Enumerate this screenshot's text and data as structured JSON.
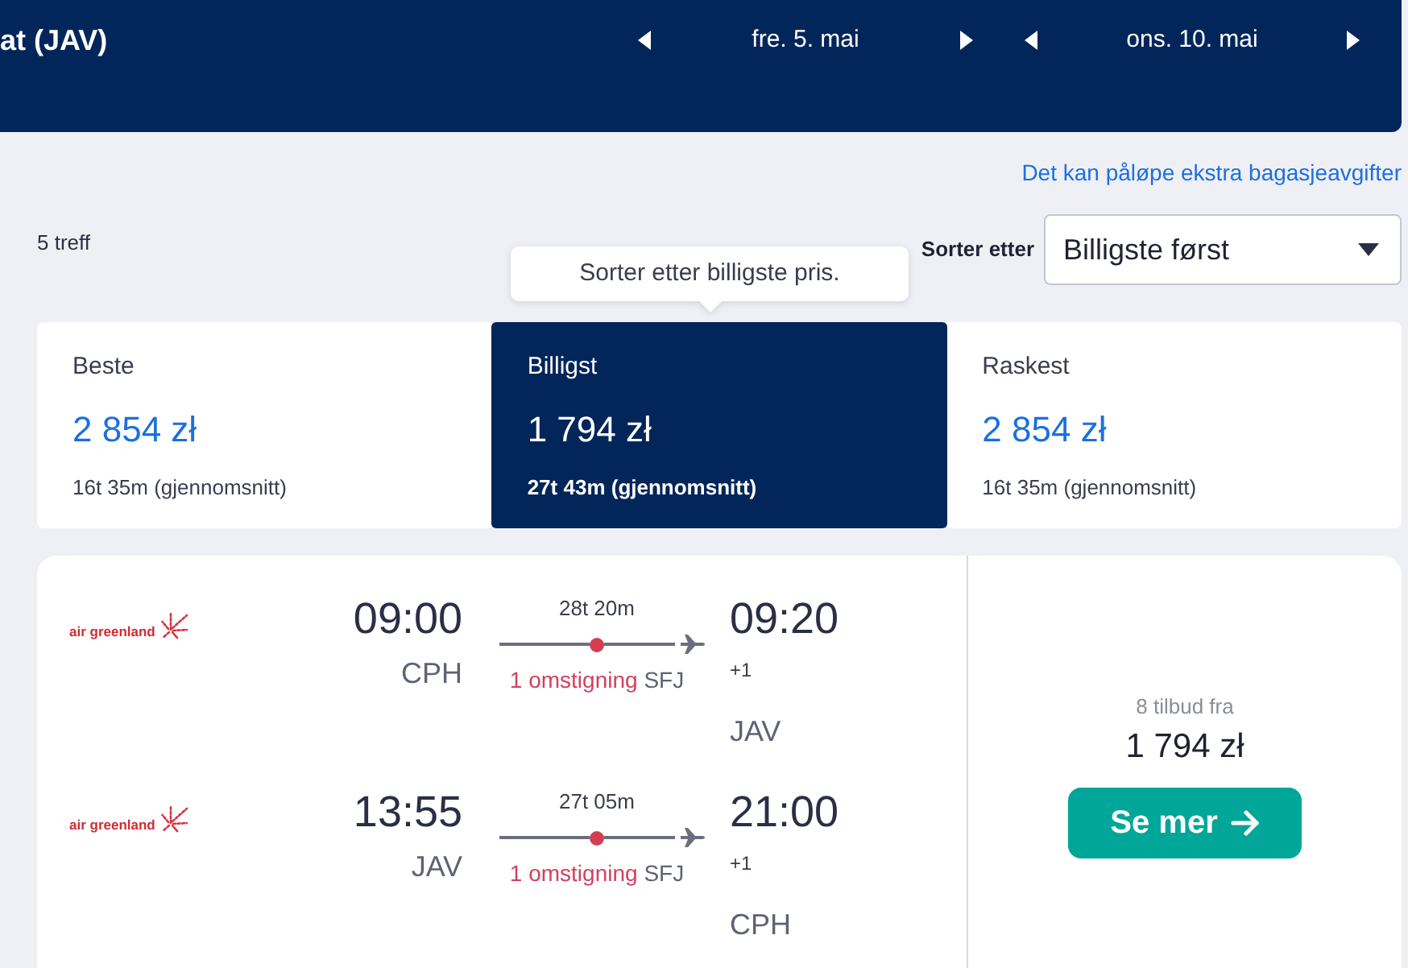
{
  "header": {
    "title": "at (JAV)",
    "dates": [
      {
        "label": "fre. 5. mai"
      },
      {
        "label": "ons. 10. mai"
      }
    ]
  },
  "baggage_note": "Det kan påløpe ekstra bagasjeavgifter",
  "result_count": "5 treff",
  "sort": {
    "label": "Sorter etter",
    "value": "Billigste først"
  },
  "tooltip": "Sorter etter billigste pris.",
  "sort_tabs": [
    {
      "label": "Beste",
      "price": "2 854 zł",
      "duration": "16t 35m (gjennomsnitt)",
      "selected": false
    },
    {
      "label": "Billigst",
      "price": "1 794 zł",
      "duration": "27t 43m (gjennomsnitt)",
      "selected": true
    },
    {
      "label": "Raskest",
      "price": "2 854 zł",
      "duration": "16t 35m (gjennomsnitt)",
      "selected": false
    }
  ],
  "results": [
    {
      "legs": [
        {
          "airline": "air greenland",
          "depart_time": "09:00",
          "depart_airport": "CPH",
          "duration": "28t 20m",
          "stops": "1 omstigning",
          "stop_airport": "SFJ",
          "arrive_time": "09:20",
          "day_offset": "+1",
          "arrive_airport": "JAV"
        },
        {
          "airline": "air greenland",
          "depart_time": "13:55",
          "depart_airport": "JAV",
          "duration": "27t 05m",
          "stops": "1 omstigning",
          "stop_airport": "SFJ",
          "arrive_time": "21:00",
          "day_offset": "+1",
          "arrive_airport": "CPH"
        }
      ],
      "offers": "8 tilbud fra",
      "price": "1 794 zł",
      "button": "Se mer"
    }
  ]
}
